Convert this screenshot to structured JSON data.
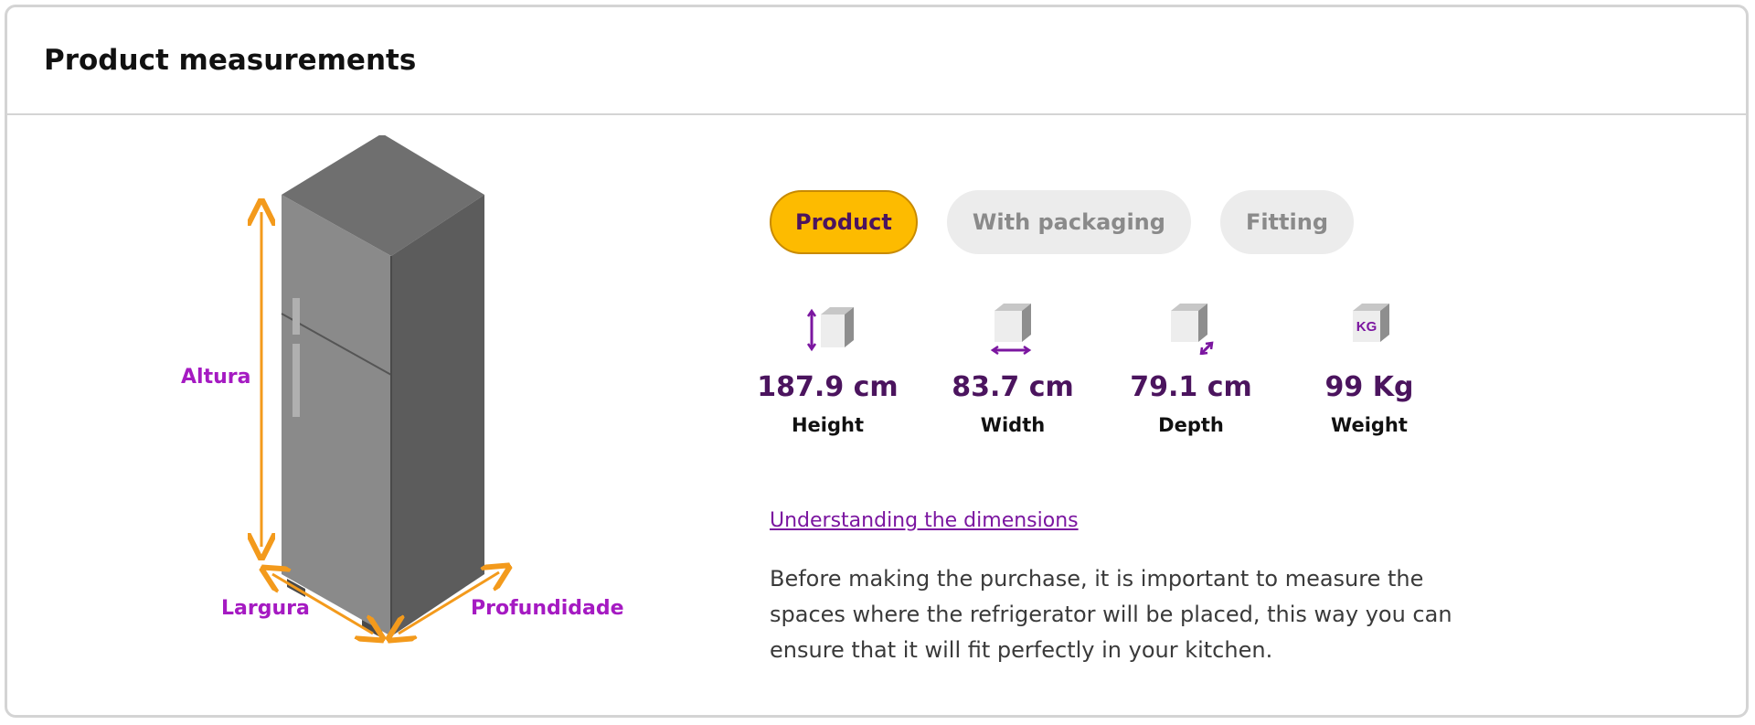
{
  "page": {
    "title": "Product measurements"
  },
  "illustration": {
    "labels": {
      "height": "Altura",
      "width": "Largura",
      "depth": "Profundidade"
    },
    "colors": {
      "arrow": "#f39a1c",
      "label": "#a51ac2",
      "body_front": "#8a8a8a",
      "body_side": "#5c5c5c",
      "body_top": "#6f6f6f"
    }
  },
  "tabs": [
    {
      "label": "Product",
      "active": true
    },
    {
      "label": "With packaging",
      "active": false
    },
    {
      "label": "Fitting",
      "active": false
    }
  ],
  "metrics": [
    {
      "value": "187.9 cm",
      "label": "Height",
      "icon": "height-box-icon"
    },
    {
      "value": "83.7 cm",
      "label": "Width",
      "icon": "width-box-icon"
    },
    {
      "value": "79.1 cm",
      "label": "Depth",
      "icon": "depth-box-icon"
    },
    {
      "value": "99 Kg",
      "label": "Weight",
      "icon": "weight-box-icon",
      "icon_text": "KG"
    }
  ],
  "help_link": "Understanding the dimensions",
  "description": "Before making the purchase, it is important to measure the spaces where the refrigerator will be placed, this way you can ensure that it will fit perfectly in your kitchen.",
  "colors": {
    "accent": "#fdbb00",
    "value_text": "#4b145e",
    "link": "#7b16a0"
  }
}
